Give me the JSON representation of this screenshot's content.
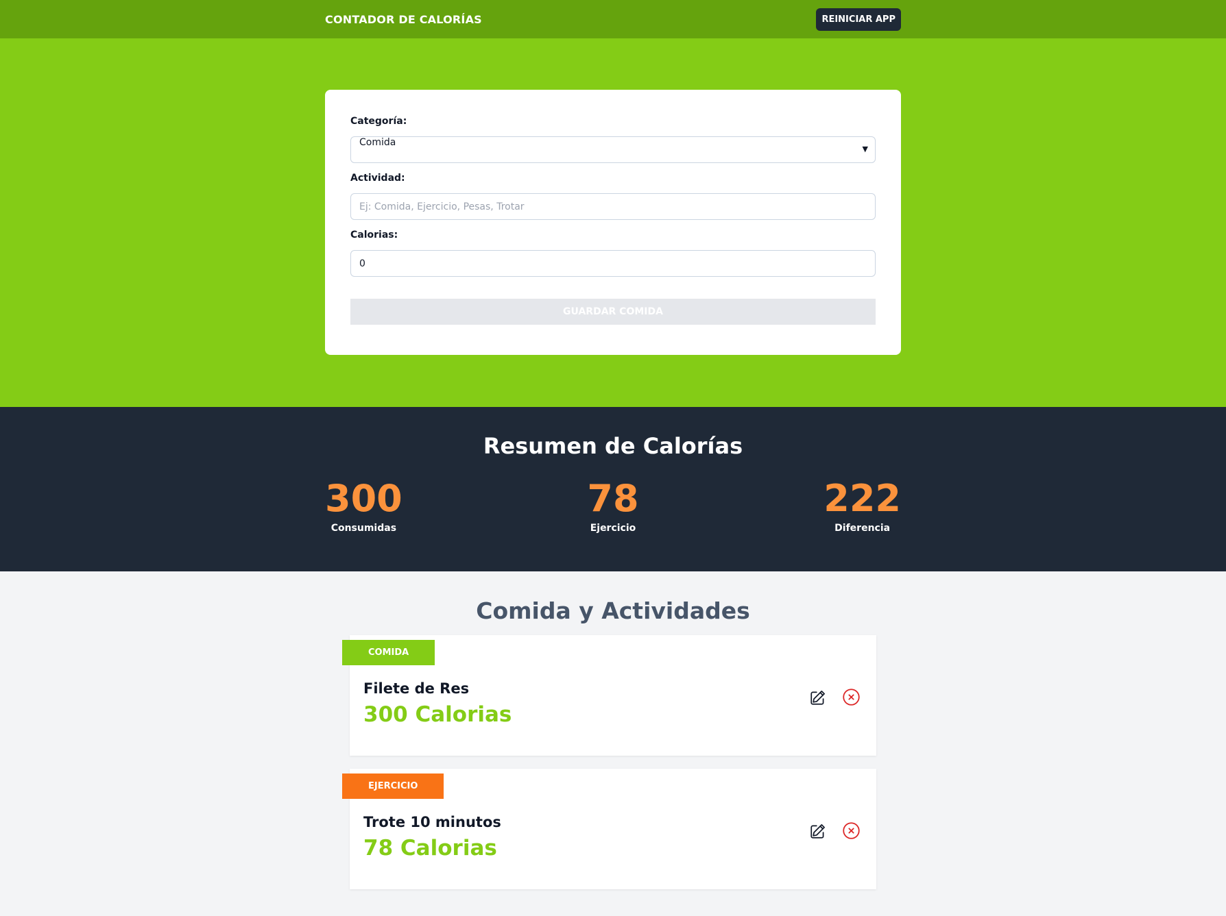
{
  "header": {
    "title": "CONTADOR DE CALORÍAS",
    "reset_label": "REINICIAR APP"
  },
  "form": {
    "category_label": "Categoría:",
    "category_value": "Comida",
    "activity_label": "Actividad:",
    "activity_placeholder": "Ej: Comida, Ejercicio, Pesas, Trotar",
    "calories_label": "Calorias:",
    "calories_value": "0",
    "save_label": "GUARDAR COMIDA"
  },
  "summary": {
    "title": "Resumen de Calorías",
    "stats": [
      {
        "value": "300",
        "label": "Consumidas"
      },
      {
        "value": "78",
        "label": "Ejercicio"
      },
      {
        "value": "222",
        "label": "Diferencia"
      }
    ]
  },
  "activities": {
    "title": "Comida y Actividades",
    "items": [
      {
        "category": "COMIDA",
        "name": "Filete de Res",
        "calories": "300 Calorias"
      },
      {
        "category": "EJERCICIO",
        "name": "Trote 10 minutos",
        "calories": "78 Calorias"
      }
    ]
  },
  "colors": {
    "header_bg": "#65a30d",
    "form_bg": "#84cc16",
    "summary_bg": "#1f2937",
    "accent_orange": "#fb923c",
    "food_badge": "#84cc16",
    "exercise_badge": "#f97316",
    "delete_red": "#dc2626"
  },
  "icons": {
    "edit": "pencil-square-icon",
    "delete": "x-circle-icon",
    "select": "chevron-down-icon"
  }
}
